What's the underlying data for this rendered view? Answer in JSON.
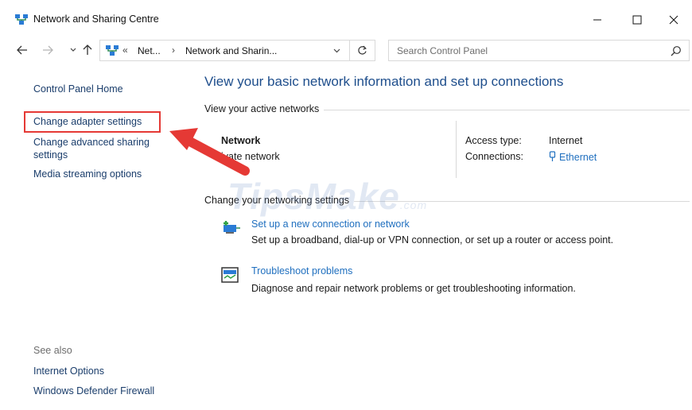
{
  "window": {
    "title": "Network and Sharing Centre",
    "controls": {
      "minimize": "—",
      "maximize": "☐",
      "close": "✕"
    }
  },
  "address": {
    "chevron": "«",
    "crumb1": "Net...",
    "separator": "›",
    "crumb2": "Network and Sharin...",
    "search_placeholder": "Search Control Panel"
  },
  "leftnav": {
    "home": "Control Panel Home",
    "adapter": "Change adapter settings",
    "advanced_line1": "Change advanced sharing",
    "advanced_line2": "settings",
    "media": "Media streaming options",
    "see_also": "See also",
    "internet_options": "Internet Options",
    "firewall": "Windows Defender Firewall"
  },
  "main": {
    "title": "View your basic network information and set up connections",
    "active_label": "View your active networks",
    "network_name": "Network",
    "network_type": "ivate network",
    "access_label": "Access type:",
    "access_value": "Internet",
    "conn_label": "Connections:",
    "conn_value": "Ethernet",
    "change_label": "Change your networking settings",
    "tasks": [
      {
        "link": "Set up a new connection or network",
        "desc": "Set up a broadband, dial-up or VPN connection, or set up a router or access point.",
        "icon": "new-connection-icon"
      },
      {
        "link": "Troubleshoot problems",
        "desc": "Diagnose and repair network problems or get troubleshooting information.",
        "icon": "troubleshoot-icon"
      }
    ]
  },
  "watermark": {
    "text": "TipsMake",
    "suffix": ".com"
  },
  "colors": {
    "link": "#1f6fbf",
    "title": "#1e4e8c",
    "highlight": "#e53935"
  }
}
